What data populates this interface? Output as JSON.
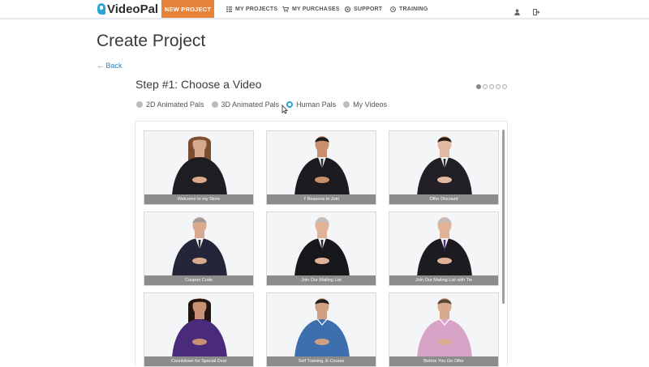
{
  "nav": {
    "logo": "VideoPal",
    "new_project": "NEW PROJECT",
    "items": [
      {
        "label": "MY PROJECTS",
        "icon": "list-icon"
      },
      {
        "label": "MY PURCHASES",
        "icon": "cart-icon"
      },
      {
        "label": "SUPPORT",
        "icon": "life-ring-icon"
      },
      {
        "label": "TRAINING",
        "icon": "clock-icon"
      }
    ],
    "user_icon": "user-icon",
    "logout_icon": "logout-icon"
  },
  "page": {
    "title": "Create Project",
    "back": "← Back",
    "step_title": "Step #1: Choose a Video",
    "step_dots": 5,
    "active_step": 1
  },
  "video_types": [
    {
      "label": "2D Animated Pals",
      "selected": false
    },
    {
      "label": "3D Animated Pals",
      "selected": false
    },
    {
      "label": "Human Pals",
      "selected": true
    },
    {
      "label": "My Videos",
      "selected": false
    }
  ],
  "videos": [
    {
      "caption": "Welcome to my Store",
      "outfit": "#1e1e22",
      "skin": "#d9a98c",
      "hair": "#7a4e2e",
      "style": "woman-long"
    },
    {
      "caption": "7 Reasons to Join",
      "outfit": "#1c1c20",
      "skin": "#c8906c",
      "hair": "#1a1a1a",
      "style": "man-suit"
    },
    {
      "caption": "Offer Discount",
      "outfit": "#222026",
      "skin": "#e2b9a2",
      "hair": "#2a1c14",
      "style": "man-suit"
    },
    {
      "caption": "Coupon Code",
      "outfit": "#25253a",
      "skin": "#d8a98e",
      "hair": "#9a9a9a",
      "style": "man-suit"
    },
    {
      "caption": "Join Our Mailing List",
      "outfit": "#18181c",
      "skin": "#e0b298",
      "hair": "#bfbfbf",
      "style": "man-suit"
    },
    {
      "caption": "Join Our Mailing List with Tie",
      "outfit": "#1b1b20",
      "skin": "#e0b298",
      "hair": "#bfbfbf",
      "style": "man-tie"
    },
    {
      "caption": "Countdown for Special Deal",
      "outfit": "#4a2a7a",
      "skin": "#c99277",
      "hair": "#221510",
      "style": "woman-long"
    },
    {
      "caption": "Self Training, E-Course",
      "outfit": "#3d6fae",
      "skin": "#d0a083",
      "hair": "#1d1d1d",
      "style": "man-shirt"
    },
    {
      "caption": "Before You Go Offer",
      "outfit": "#d7a3c7",
      "skin": "#d9aa8e",
      "hair": "#5a4536",
      "style": "man-shirt"
    }
  ]
}
